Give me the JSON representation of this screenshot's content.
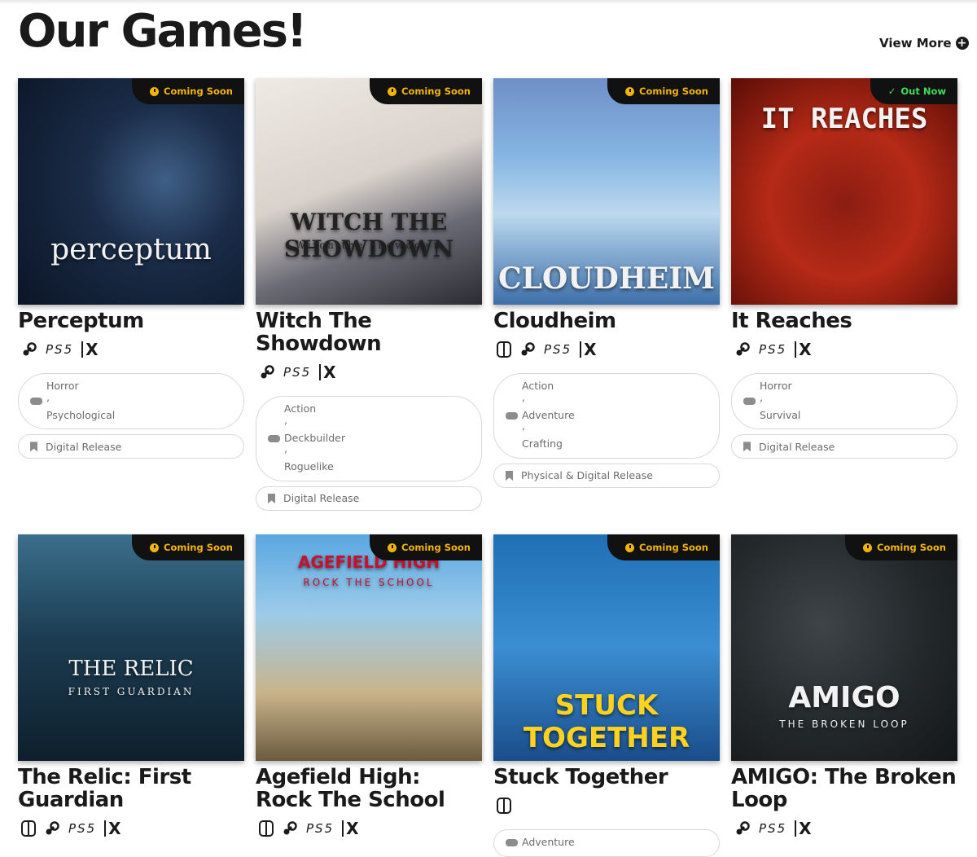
{
  "header": {
    "title": "Our Games!",
    "view_more": "View More"
  },
  "badges": {
    "soon": "Coming Soon",
    "out": "Out Now"
  },
  "platform_labels": {
    "ps5": "PS5",
    "xbox": "X"
  },
  "games": [
    {
      "title": "Perceptum",
      "status": "Coming Soon",
      "cover_text": "perceptum",
      "cover_sub": "",
      "platforms": [
        "steam",
        "ps5",
        "xbox"
      ],
      "genres": [
        "Horror",
        "Psychological"
      ],
      "release": "Digital Release"
    },
    {
      "title": "Witch The Showdown",
      "status": "Coming Soon",
      "cover_text": "WITCH THE SHOWDOWN",
      "cover_sub": "Witch the showdown",
      "platforms": [
        "steam",
        "ps5",
        "xbox"
      ],
      "genres": [
        "Action",
        "Deckbuilder",
        "Roguelike"
      ],
      "release": "Digital Release"
    },
    {
      "title": "Cloudheim",
      "status": "Coming Soon",
      "cover_text": "CLOUDHEIM",
      "cover_sub": "",
      "platforms": [
        "switch",
        "steam",
        "ps5",
        "xbox"
      ],
      "genres": [
        "Action",
        "Adventure",
        "Crafting"
      ],
      "release": "Physical & Digital Release"
    },
    {
      "title": "It Reaches",
      "status": "Out Now",
      "cover_text": "IT REACHES",
      "cover_sub": "",
      "platforms": [
        "steam",
        "ps5",
        "xbox"
      ],
      "genres": [
        "Horror",
        "Survival"
      ],
      "release": "Digital Release"
    },
    {
      "title": "The Relic: First Guardian",
      "status": "Coming Soon",
      "cover_text": "THE RELIC",
      "cover_sub": "FIRST GUARDIAN",
      "platforms": [
        "switch",
        "steam",
        "ps5",
        "xbox"
      ],
      "genres": [],
      "release": ""
    },
    {
      "title": "Agefield High: Rock The School",
      "status": "Coming Soon",
      "cover_text": "AGEFIELD HIGH",
      "cover_sub": "ROCK THE SCHOOL",
      "platforms": [
        "switch",
        "steam",
        "ps5",
        "xbox"
      ],
      "genres": [],
      "release": ""
    },
    {
      "title": "Stuck Together",
      "status": "Coming Soon",
      "cover_text": "STUCK TOGETHER",
      "cover_sub": "",
      "platforms": [
        "switch"
      ],
      "genres": [
        "Adventure"
      ],
      "release": ""
    },
    {
      "title": "AMIGO: The Broken Loop",
      "status": "Coming Soon",
      "cover_text": "AMIGO",
      "cover_sub": "THE BROKEN LOOP",
      "platforms": [
        "steam",
        "ps5",
        "xbox"
      ],
      "genres": [],
      "release": ""
    }
  ],
  "colors": {
    "badge_bg": "#111111",
    "soon": "#f5b400",
    "out": "#3ddc5a",
    "text": "#1a1a1a",
    "muted": "#6b6b6b"
  }
}
